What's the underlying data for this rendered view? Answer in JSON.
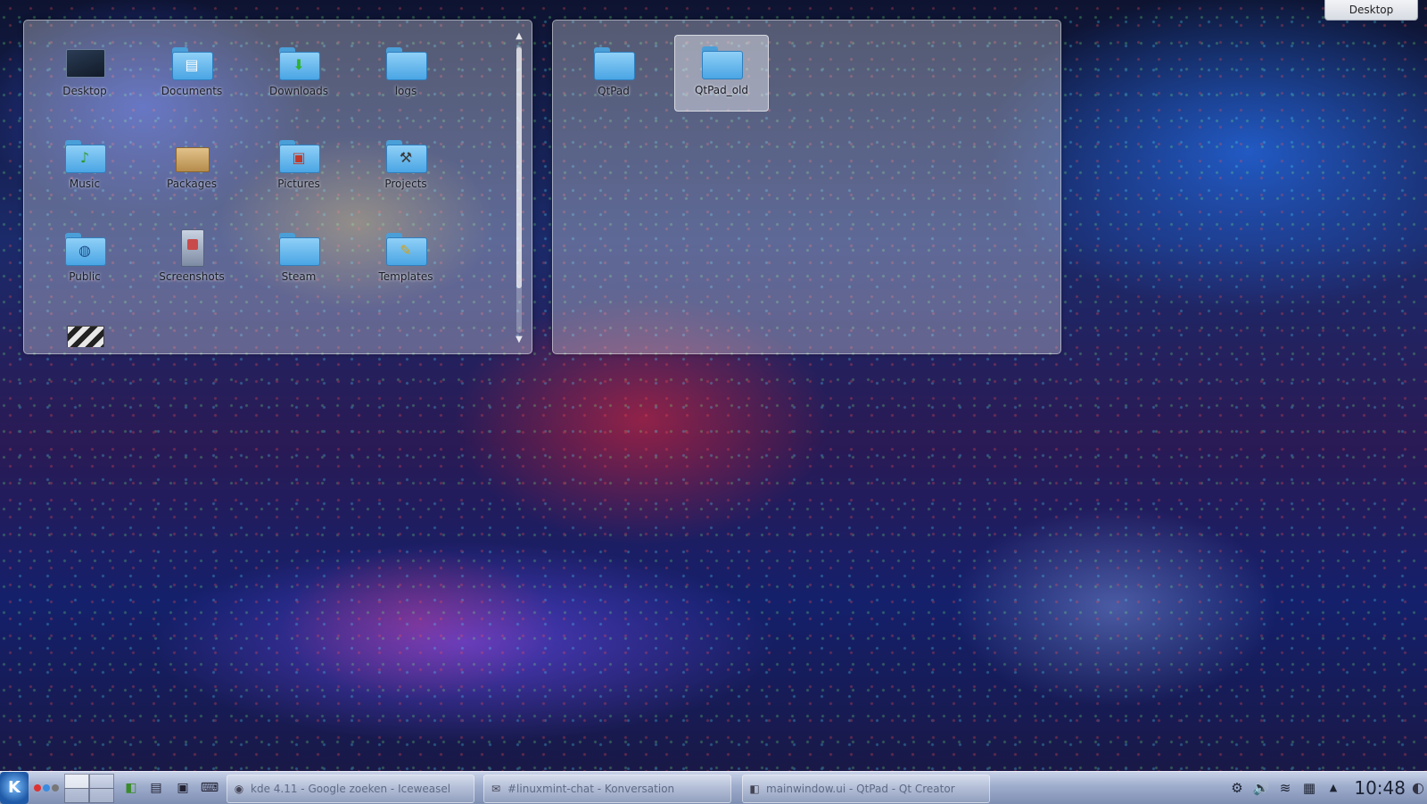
{
  "desktop": {
    "toolbox_label": "Desktop"
  },
  "folderview_home": {
    "items": [
      {
        "label": "Desktop"
      },
      {
        "label": "Documents"
      },
      {
        "label": "Downloads"
      },
      {
        "label": "logs"
      },
      {
        "label": "Music"
      },
      {
        "label": "Packages"
      },
      {
        "label": "Pictures"
      },
      {
        "label": "Projects"
      },
      {
        "label": "Public"
      },
      {
        "label": "Screenshots"
      },
      {
        "label": "Steam"
      },
      {
        "label": "Templates"
      }
    ]
  },
  "folderview_qtpad": {
    "items": [
      {
        "label": "QtPad"
      },
      {
        "label": "QtPad_old"
      }
    ]
  },
  "taskbar": {
    "kickoff_label": "K",
    "tasks": [
      {
        "title": "kde 4.11 - Google zoeken - Iceweasel"
      },
      {
        "title": "#linuxmint-chat - Konversation"
      },
      {
        "title": "mainwindow.ui - QtPad - Qt Creator"
      }
    ],
    "clock": "10:48"
  },
  "colors": {
    "folder_blue": "#4aa5e4",
    "panel": "#9eaccc"
  }
}
